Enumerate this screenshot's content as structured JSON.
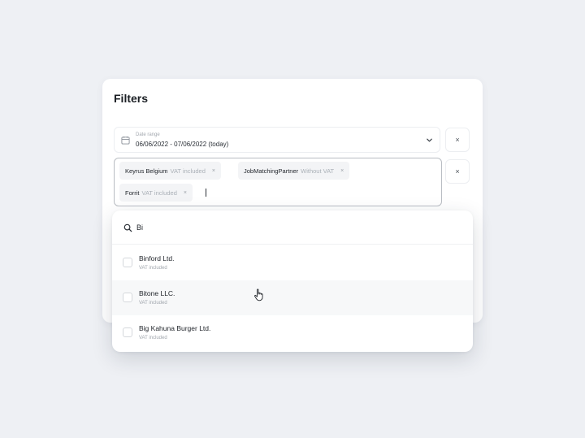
{
  "panel": {
    "title": "Filters",
    "date": {
      "label": "Date range",
      "value": "06/06/2022 - 07/06/2022 (today)"
    },
    "tags": [
      {
        "name": "Keyrus Belgium",
        "vat": "VAT included"
      },
      {
        "name": "JobMatchingPartner",
        "vat": "Without VAT"
      },
      {
        "name": "Forrit",
        "vat": "VAT included"
      }
    ],
    "remove_symbol": "×",
    "close_symbol": "×"
  },
  "search": {
    "value": "Bi",
    "placeholder": ""
  },
  "options": [
    {
      "name": "Binford Ltd.",
      "vat": "VAT included",
      "checked": false
    },
    {
      "name": "Bitone LLC.",
      "vat": "VAT included",
      "checked": false,
      "hovered": true
    },
    {
      "name": "Big Kahuna Burger Ltd.",
      "vat": "VAT included",
      "checked": false
    }
  ],
  "colors": {
    "background": "#eef0f4",
    "panel": "#ffffff",
    "tag": "#f3f4f6",
    "border_active": "#b9bdc3"
  }
}
